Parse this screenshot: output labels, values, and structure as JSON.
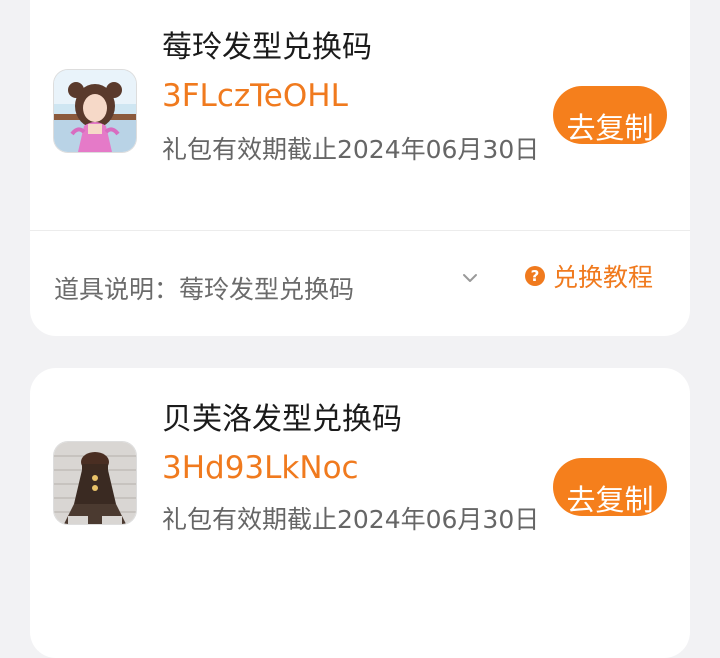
{
  "theme": {
    "accent": "#f57f1c",
    "card_bg": "#ffffff",
    "page_bg": "#f2f2f4"
  },
  "gifts": [
    {
      "title": "莓玲发型兑换码",
      "code": "3FLczTeOHL",
      "validity": "礼包有效期截止2024年06月30日",
      "copy_label": "去复制",
      "description": "道具说明：莓玲发型兑换码",
      "tutorial_label": "兑换教程",
      "tutorial_icon": "question-icon",
      "expand_icon": "chevron-down-icon"
    },
    {
      "title": "贝芙洛发型兑换码",
      "code": "3Hd93LkNoc",
      "validity": "礼包有效期截止2024年06月30日",
      "copy_label": "去复制"
    }
  ]
}
